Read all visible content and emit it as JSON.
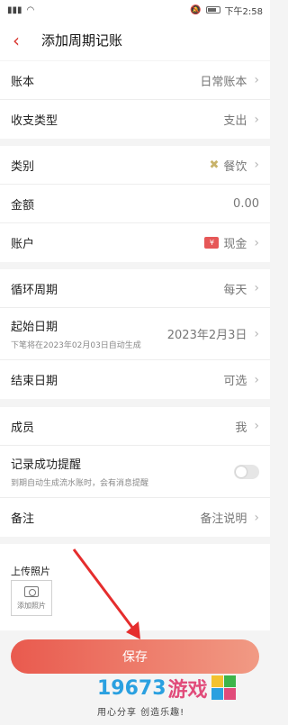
{
  "status_bar": {
    "time": "下午2:58"
  },
  "header": {
    "title": "添加周期记账"
  },
  "group1": [
    {
      "label": "账本",
      "value": "日常账本"
    },
    {
      "label": "收支类型",
      "value": "支出"
    }
  ],
  "group2": [
    {
      "label": "类别",
      "value": "餐饮",
      "icon": "fork-knife-icon"
    },
    {
      "label": "金额",
      "value": "0.00"
    },
    {
      "label": "账户",
      "value": "现金",
      "icon": "cash-icon"
    }
  ],
  "group3": [
    {
      "label": "循环周期",
      "value": "每天"
    },
    {
      "label": "起始日期",
      "value": "2023年2月3日",
      "sub": "下笔将在2023年02月03日自动生成"
    },
    {
      "label": "结束日期",
      "value": "可选"
    }
  ],
  "group4": [
    {
      "label": "成员",
      "value": "我"
    },
    {
      "label": "记录成功提醒",
      "sub": "到期自动生成流水账时，会有消息提醒",
      "toggle": false
    },
    {
      "label": "备注",
      "placeholder": "备注说明"
    }
  ],
  "upload": {
    "title": "上传照片",
    "button": "添加照片"
  },
  "save_button": "保存",
  "watermark": {
    "number": "19673",
    "name": "游戏",
    "slogan": "用心分享 创造乐趣!"
  },
  "colors": {
    "accent": "#d9362f",
    "button_start": "#e95a4e",
    "button_end": "#f19a84"
  }
}
